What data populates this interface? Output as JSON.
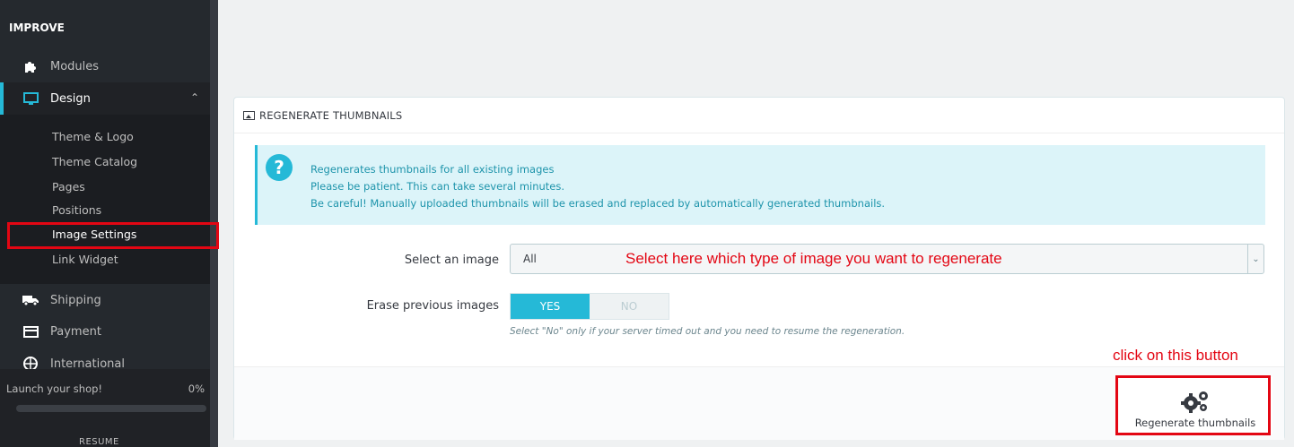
{
  "sidebar": {
    "section_title": "IMPROVE",
    "items": [
      {
        "label": "Modules",
        "icon": "puzzle-icon"
      },
      {
        "label": "Design",
        "icon": "monitor-icon"
      },
      {
        "label": "Shipping",
        "icon": "truck-icon"
      },
      {
        "label": "Payment",
        "icon": "credit-card-icon"
      },
      {
        "label": "International",
        "icon": "globe-icon"
      }
    ],
    "submenu": [
      "Theme & Logo",
      "Theme Catalog",
      "Pages",
      "Positions",
      "Image Settings",
      "Link Widget"
    ],
    "launch": {
      "label": "Launch your shop!",
      "percent": "0%",
      "progress": 0,
      "resume": "RESUME"
    }
  },
  "panel": {
    "title": "REGENERATE THUMBNAILS",
    "alert_lines": [
      "Regenerates thumbnails for all existing images",
      "Please be patient. This can take several minutes.",
      "Be careful! Manually uploaded thumbnails will be erased and replaced by automatically generated thumbnails."
    ],
    "select_label": "Select an image",
    "select_value": "All",
    "select_annotation": "Select here which type of image you want to regenerate",
    "erase_label": "Erase previous images",
    "toggle_yes": "YES",
    "toggle_no": "NO",
    "toggle_selected": "YES",
    "help_text": "Select \"No\" only if your server timed out and you need to resume the regeneration.",
    "button_annotation": "click on this button",
    "button_label": "Regenerate thumbnails"
  },
  "colors": {
    "accent": "#25b9d7",
    "annotation": "#e30613",
    "sidebar": "#25292e"
  }
}
